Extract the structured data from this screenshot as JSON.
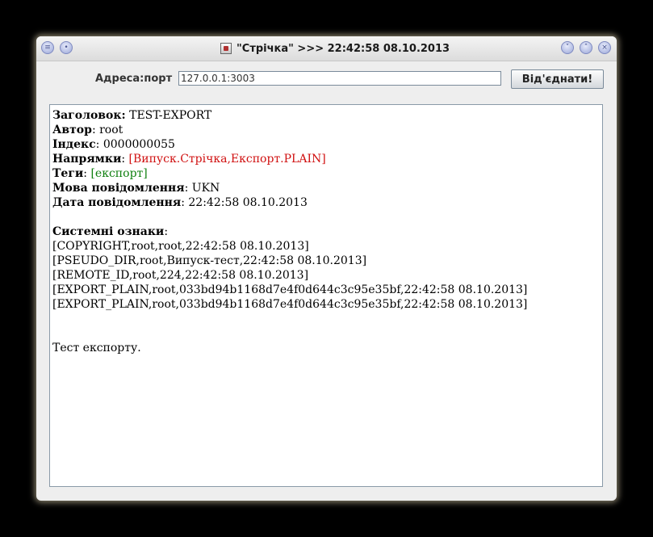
{
  "window": {
    "title": "\"Стрічка\" >>> 22:42:58 08.10.2013"
  },
  "toolbar": {
    "address_label": "Адреса:порт",
    "address_value": "127.0.0.1:3003",
    "disconnect_label": "Від'єднати!"
  },
  "message": {
    "header": {
      "label": "Заголовок",
      "value": "TEST-EXPORT"
    },
    "author": {
      "label": "Автор",
      "value": "root"
    },
    "index": {
      "label": "Індекс",
      "value": "0000000055"
    },
    "directions": {
      "label": "Напрямки",
      "value": "[Випуск.Стрічка,Експорт.PLAIN]"
    },
    "tags": {
      "label": "Теги",
      "value": "[експорт]"
    },
    "language": {
      "label": "Мова повідомлення",
      "value": "UKN"
    },
    "date": {
      "label": "Дата повідомлення",
      "value": "22:42:58 08.10.2013"
    },
    "system_marks_label": "Системні ознаки",
    "system_marks": [
      "[COPYRIGHT,root,root,22:42:58 08.10.2013]",
      "[PSEUDO_DIR,root,Випуск-тест,22:42:58 08.10.2013]",
      "[REMOTE_ID,root,224,22:42:58 08.10.2013]",
      "[EXPORT_PLAIN,root,033bd94b1168d7e4f0d644c3c95e35bf,22:42:58 08.10.2013]",
      "[EXPORT_PLAIN,root,033bd94b1168d7e4f0d644c3c95e35bf,22:42:58 08.10.2013]"
    ],
    "body": "Тест експорту."
  },
  "colors": {
    "directions": "#d01010",
    "tags": "#108010"
  },
  "icons": {
    "window_menu": "menu-icon",
    "window_pin": "pin-icon",
    "minimize": "chevron-down-icon",
    "maximize": "chevron-up-icon",
    "close": "close-icon",
    "app": "app-icon"
  }
}
